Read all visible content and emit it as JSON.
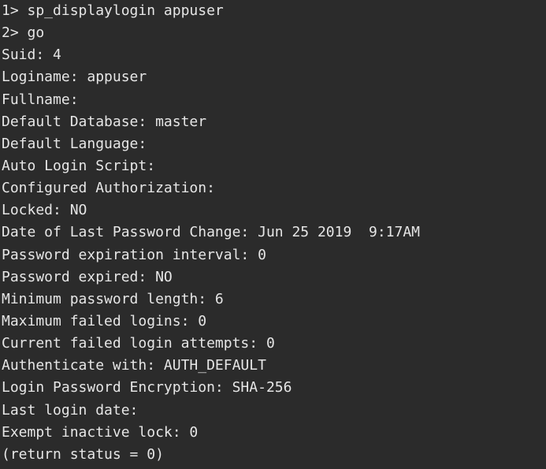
{
  "terminal": {
    "lines": [
      "1> sp_displaylogin appuser",
      "2> go",
      "Suid: 4",
      "Loginame: appuser",
      "Fullname:",
      "Default Database: master",
      "Default Language:",
      "Auto Login Script:",
      "Configured Authorization:",
      "Locked: NO",
      "Date of Last Password Change: Jun 25 2019  9:17AM",
      "Password expiration interval: 0",
      "Password expired: NO",
      "Minimum password length: 6",
      "Maximum failed logins: 0",
      "Current failed login attempts: 0",
      "Authenticate with: AUTH_DEFAULT",
      "Login Password Encryption: SHA-256",
      "Last login date:",
      "Exempt inactive lock: 0",
      "(return status = 0)"
    ],
    "colors": {
      "background": "#2b2b2b",
      "foreground": "#e6e6e6",
      "cursor": "#f2f2f2"
    }
  }
}
